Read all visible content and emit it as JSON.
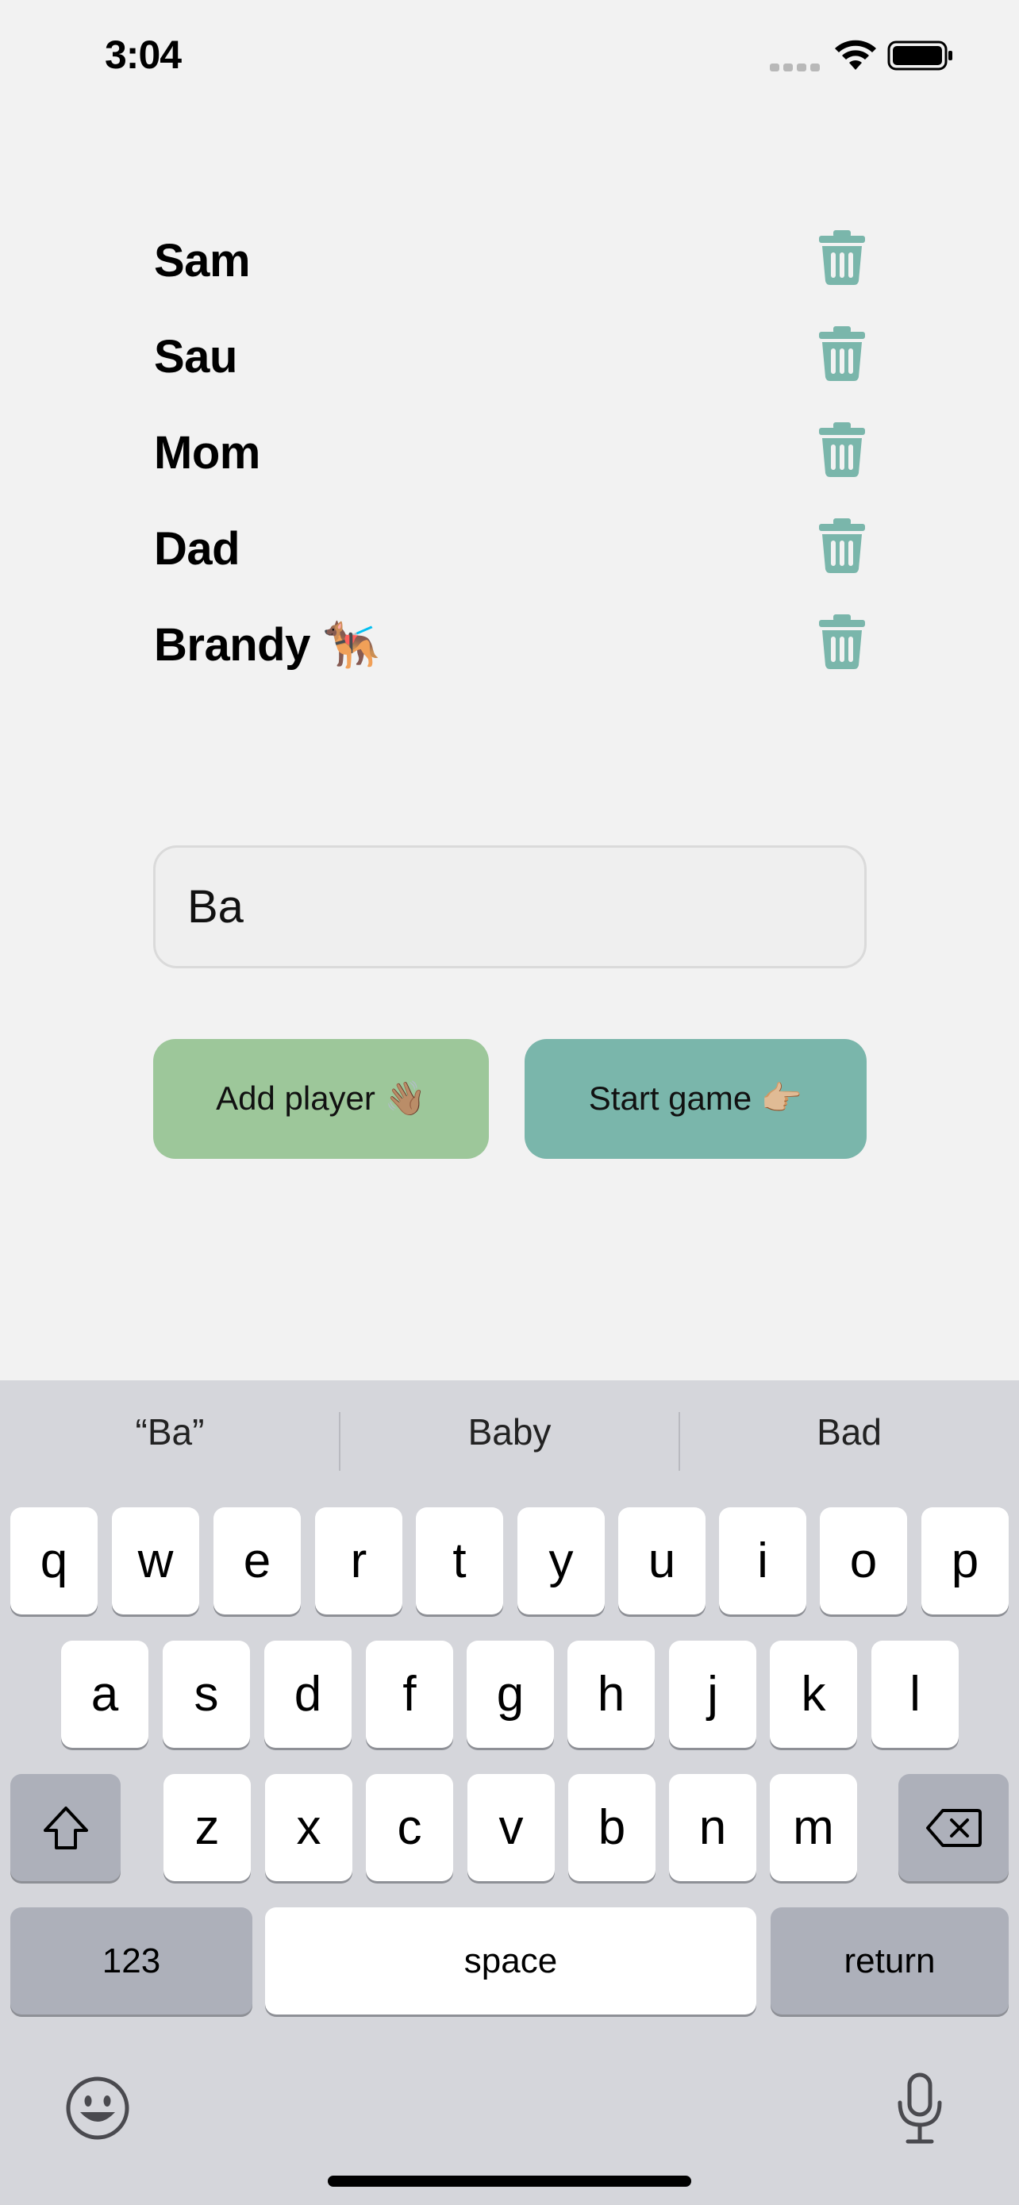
{
  "status_bar": {
    "time": "3:04",
    "icons": [
      "signal-icon",
      "wifi-icon",
      "battery-icon"
    ]
  },
  "players": [
    {
      "name": "Sam"
    },
    {
      "name": "Sau"
    },
    {
      "name": "Mom"
    },
    {
      "name": "Dad"
    },
    {
      "name": "Brandy 🐕‍🦺"
    }
  ],
  "name_input": {
    "value": "Ba"
  },
  "buttons": {
    "add_player": "Add player 👋🏽",
    "start_game": "Start game 👉🏼"
  },
  "keyboard": {
    "suggestions": [
      "“Ba”",
      "Baby",
      "Bad"
    ],
    "row1": [
      "q",
      "w",
      "e",
      "r",
      "t",
      "y",
      "u",
      "i",
      "o",
      "p"
    ],
    "row2": [
      "a",
      "s",
      "d",
      "f",
      "g",
      "h",
      "j",
      "k",
      "l"
    ],
    "row3": [
      "z",
      "x",
      "c",
      "v",
      "b",
      "n",
      "m"
    ],
    "numbers_key": "123",
    "space_key": "space",
    "return_key": "return"
  },
  "colors": {
    "background": "#f2f2f2",
    "trash_icon": "#7ab6ab",
    "add_button": "#9dc79a",
    "start_button": "#7ab6ab",
    "keyboard_bg": "#d5d6db"
  }
}
